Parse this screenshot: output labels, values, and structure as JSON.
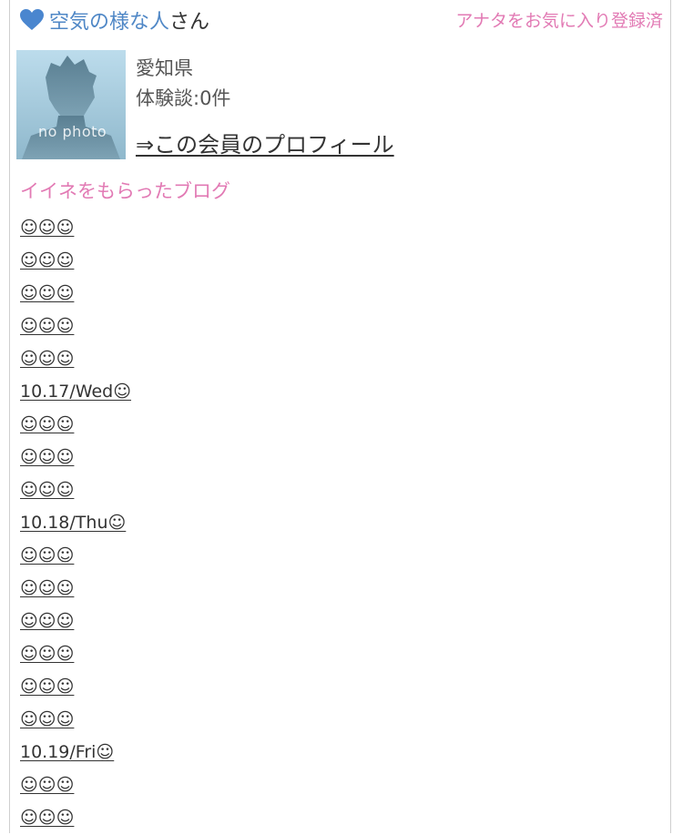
{
  "member": {
    "name": "空気の様な人",
    "suffix": "さん",
    "favorite_status": "アナタをお気に入り登録済",
    "prefecture": "愛知県",
    "experience_count": "体験談:0件",
    "profile_link": "⇒この会員のプロフィール",
    "avatar_caption": "no photo",
    "heart_icon": "heart-icon",
    "heart_color": "#4a86cf"
  },
  "blog": {
    "section_title": "イイネをもらったブログ",
    "posts": [
      "☺☺☺",
      "☺☺☺",
      "☺☺☺",
      "☺☺☺",
      "☺☺☺",
      "10.17/Wed☺",
      "☺☺☺",
      "☺☺☺",
      "☺☺☺",
      "10.18/Thu☺",
      "☺☺☺",
      "☺☺☺",
      "☺☺☺",
      "☺☺☺",
      "☺☺☺",
      "☺☺☺",
      "10.19/Fri☺",
      "☺☺☺",
      "☺☺☺"
    ]
  },
  "colors": {
    "accent_pink": "#e27ab4",
    "name_blue": "#4f87c6"
  }
}
